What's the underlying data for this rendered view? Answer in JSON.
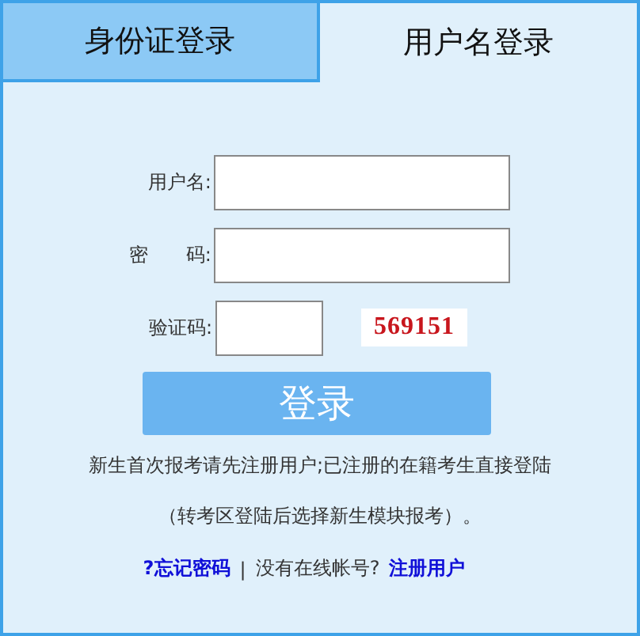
{
  "tabs": [
    {
      "label": "身份证登录",
      "selected": false
    },
    {
      "label": "用户名登录",
      "selected": true
    }
  ],
  "fields": [
    {
      "label": "用户名:",
      "kind": "text"
    },
    {
      "label": "密　　码:",
      "kind": "password"
    },
    {
      "label": "验证码:",
      "kind": "captcha",
      "captcha": "569151"
    }
  ],
  "login_button": "登录",
  "notice": [
    "新生首次报考请先注册用户;已注册的在籍考生直接登陆",
    "（转考区登陆后选择新生模块报考）。"
  ],
  "links": {
    "forgot": "?忘记密码",
    "separator": "|",
    "question": "没有在线帐号?",
    "register": "注册用户"
  }
}
